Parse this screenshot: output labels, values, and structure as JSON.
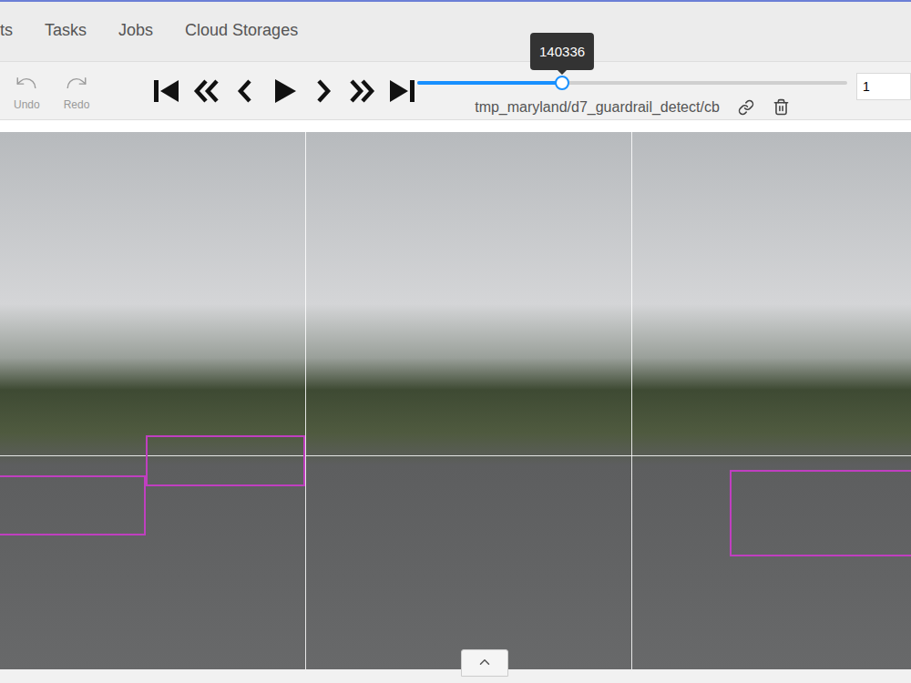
{
  "nav": {
    "items": [
      {
        "label": "ts"
      },
      {
        "label": "Tasks"
      },
      {
        "label": "Jobs"
      },
      {
        "label": "Cloud Storages"
      }
    ]
  },
  "history": [
    {
      "label": "Undo",
      "kind": "undo",
      "disabled": true
    },
    {
      "label": "Redo",
      "kind": "redo",
      "disabled": true
    }
  ],
  "slider": {
    "level": 0.337,
    "tooltip": "140336"
  },
  "filename": "tmp_maryland/d7_guardrail_detect/cb",
  "frame_input": {
    "value": "1"
  }
}
